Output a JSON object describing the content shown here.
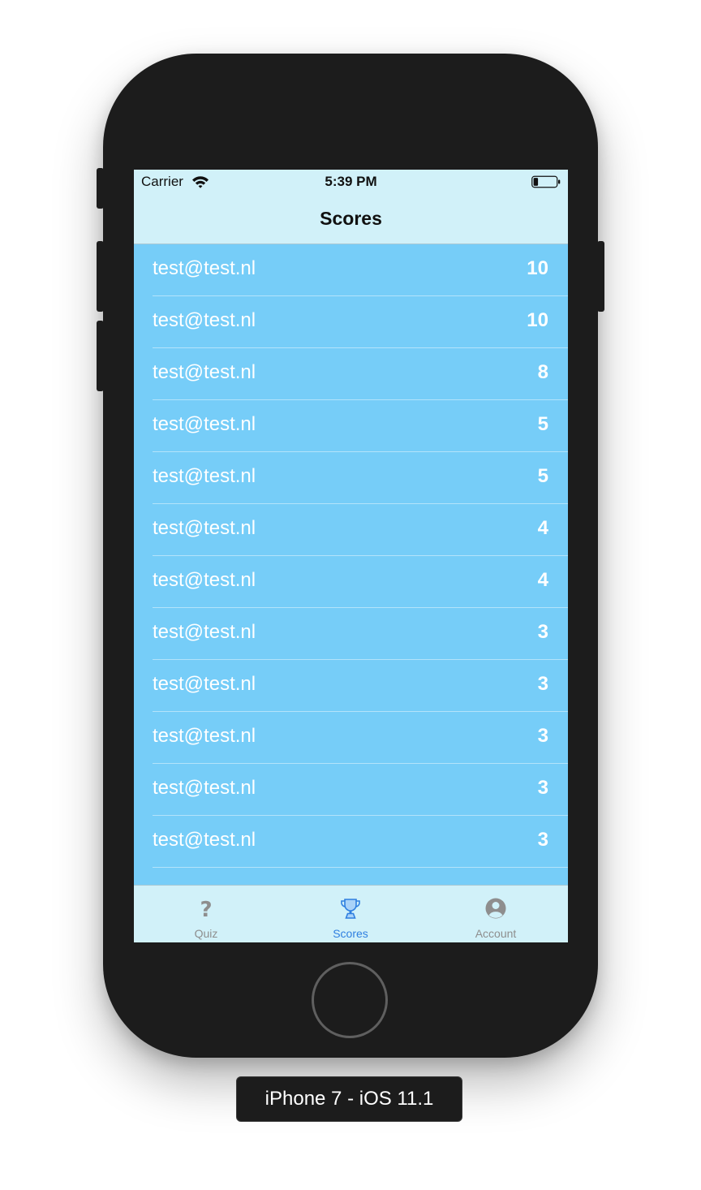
{
  "status_bar": {
    "carrier": "Carrier",
    "time": "5:39 PM"
  },
  "nav": {
    "title": "Scores"
  },
  "scores": [
    {
      "email": "test@test.nl",
      "score": "10"
    },
    {
      "email": "test@test.nl",
      "score": "10"
    },
    {
      "email": "test@test.nl",
      "score": "8"
    },
    {
      "email": "test@test.nl",
      "score": "5"
    },
    {
      "email": "test@test.nl",
      "score": "5"
    },
    {
      "email": "test@test.nl",
      "score": "4"
    },
    {
      "email": "test@test.nl",
      "score": "4"
    },
    {
      "email": "test@test.nl",
      "score": "3"
    },
    {
      "email": "test@test.nl",
      "score": "3"
    },
    {
      "email": "test@test.nl",
      "score": "3"
    },
    {
      "email": "test@test.nl",
      "score": "3"
    },
    {
      "email": "test@test.nl",
      "score": "3"
    }
  ],
  "tabs": [
    {
      "label": "Quiz",
      "icon": "question-icon",
      "active": false
    },
    {
      "label": "Scores",
      "icon": "trophy-icon",
      "active": true
    },
    {
      "label": "Account",
      "icon": "account-icon",
      "active": false
    }
  ],
  "device": {
    "label": "iPhone 7 - iOS 11.1"
  },
  "colors": {
    "list_background": "#76cdf8",
    "bar_background": "#d1f1f9",
    "active_tab": "#2f7fe0",
    "inactive_tab": "#8e8e8e"
  }
}
